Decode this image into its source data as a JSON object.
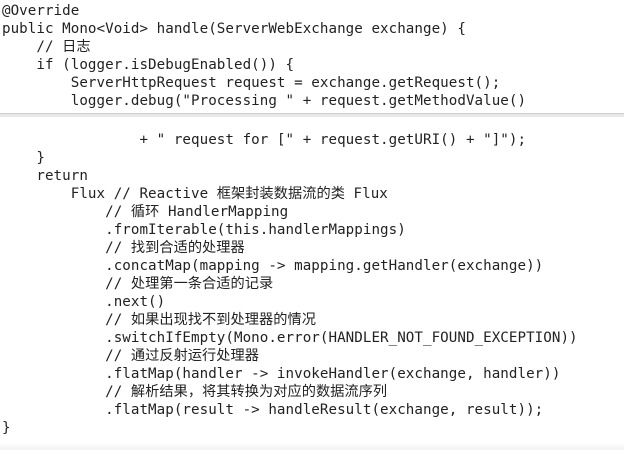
{
  "code": {
    "top_lines": [
      "@Override",
      "public Mono<Void> handle(ServerWebExchange exchange) {",
      "    // 日志",
      "    if (logger.isDebugEnabled()) {",
      "        ServerHttpRequest request = exchange.getRequest();",
      "        logger.debug(\"Processing \" + request.getMethodValue()"
    ],
    "bottom_lines": [
      "                + \" request for [\" + request.getURI() + \"]\");",
      "    }",
      "    return",
      "        Flux // Reactive 框架封装数据流的类 Flux",
      "            // 循环 HandlerMapping",
      "            .fromIterable(this.handlerMappings)",
      "            // 找到合适的处理器",
      "            .concatMap(mapping -> mapping.getHandler(exchange))",
      "            // 处理第一条合适的记录",
      "            .next()",
      "            // 如果出现找不到处理器的情况",
      "            .switchIfEmpty(Mono.error(HANDLER_NOT_FOUND_EXCEPTION))",
      "            // 通过反射运行处理器",
      "            .flatMap(handler -> invokeHandler(exchange, handler))",
      "            // 解析结果，将其转换为对应的数据流序列",
      "            .flatMap(result -> handleResult(exchange, result));",
      "}"
    ]
  }
}
